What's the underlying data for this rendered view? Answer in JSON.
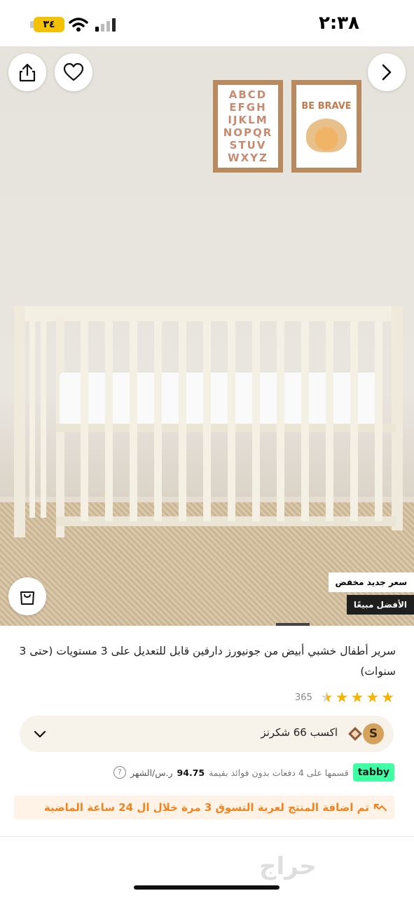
{
  "status_bar": {
    "time": "٢:٣٨",
    "battery": "٣٤"
  },
  "hero": {
    "poster_abc_lines": [
      "ABCD",
      "EFGH",
      "IJKLM",
      "NOPQR",
      "STUV",
      "WXYZ"
    ],
    "poster_brave_text": "BE BRAVE",
    "badge_discount": "سعر جديد مخفض",
    "badge_best_seller": "الأفضل مبيعًا",
    "icons": {
      "share": "share-icon",
      "favorite": "heart-icon",
      "next": "chevron-right-icon",
      "cart": "shopping-bag-icon"
    }
  },
  "product": {
    "title": "سرير أطفال خشبي أبيض من جونيورز دارفين قابل للتعديل على 3 مستويات (حتى 3 سنوات)",
    "rating": 4.5,
    "rating_count": "365"
  },
  "points": {
    "coin_letter": "S",
    "text": "اكسب 66 شكرنز"
  },
  "tabby": {
    "logo": "tabby",
    "text": "قسمها على 4 دفعات بدون فوائد بقيمة",
    "amount": "94.75",
    "unit": "ر.س/الشهر",
    "info": "?"
  },
  "trend": {
    "text": "تم اضافة المنتج لعربة التسوق 3 مرة خلال ال 24 ساعة الماضية"
  },
  "colors": {
    "star": "#f4b400",
    "tabby": "#3effa3",
    "trend": "#f0851f",
    "battery": "#f2c200"
  }
}
